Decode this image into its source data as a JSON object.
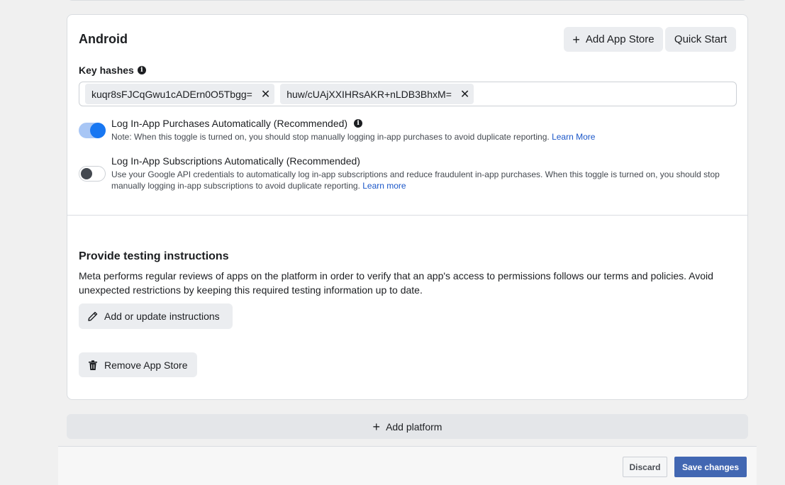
{
  "platform": {
    "title": "Android",
    "add_store_label": "Add App Store",
    "quick_start_label": "Quick Start"
  },
  "key_hashes": {
    "label": "Key hashes",
    "values": [
      "kuqr8sFJCqGwu1cADErn0O5Tbgg=",
      "huw/cUAjXXIHRsAKR+nLDB3BhxM="
    ]
  },
  "toggles": [
    {
      "title": "Log In-App Purchases Automatically (Recommended)",
      "note": "Note: When this toggle is turned on, you should stop manually logging in-app purchases to avoid duplicate reporting.",
      "link": "Learn More",
      "on": true
    },
    {
      "title": "Log In-App Subscriptions Automatically (Recommended)",
      "note_line1": "Use your Google API credentials to automatically log in-app subscriptions and reduce fraudulent in-app purchases. When this toggle is turned on, you should stop",
      "note_line2": "manually logging in-app subscriptions to avoid duplicate reporting.",
      "link": "Learn more",
      "on": false
    }
  ],
  "testing": {
    "title": "Provide testing instructions",
    "description": "Meta performs regular reviews of apps on the platform in order to verify that an app's access to permissions follows our terms and policies. Avoid unexpected restrictions by keeping this required testing information up to date.",
    "button_label": "Add or update instructions"
  },
  "remove_label": "Remove App Store",
  "add_platform_label": "Add platform",
  "footer": {
    "discard_label": "Discard",
    "save_label": "Save changes"
  },
  "colors": {
    "accent": "#1877f2",
    "save": "#4267b2",
    "link": "#1a56c8"
  },
  "icons": {
    "plus": "plus-icon",
    "info": "info-icon",
    "close": "close-icon",
    "pencil": "pencil-icon",
    "trash": "trash-icon"
  }
}
